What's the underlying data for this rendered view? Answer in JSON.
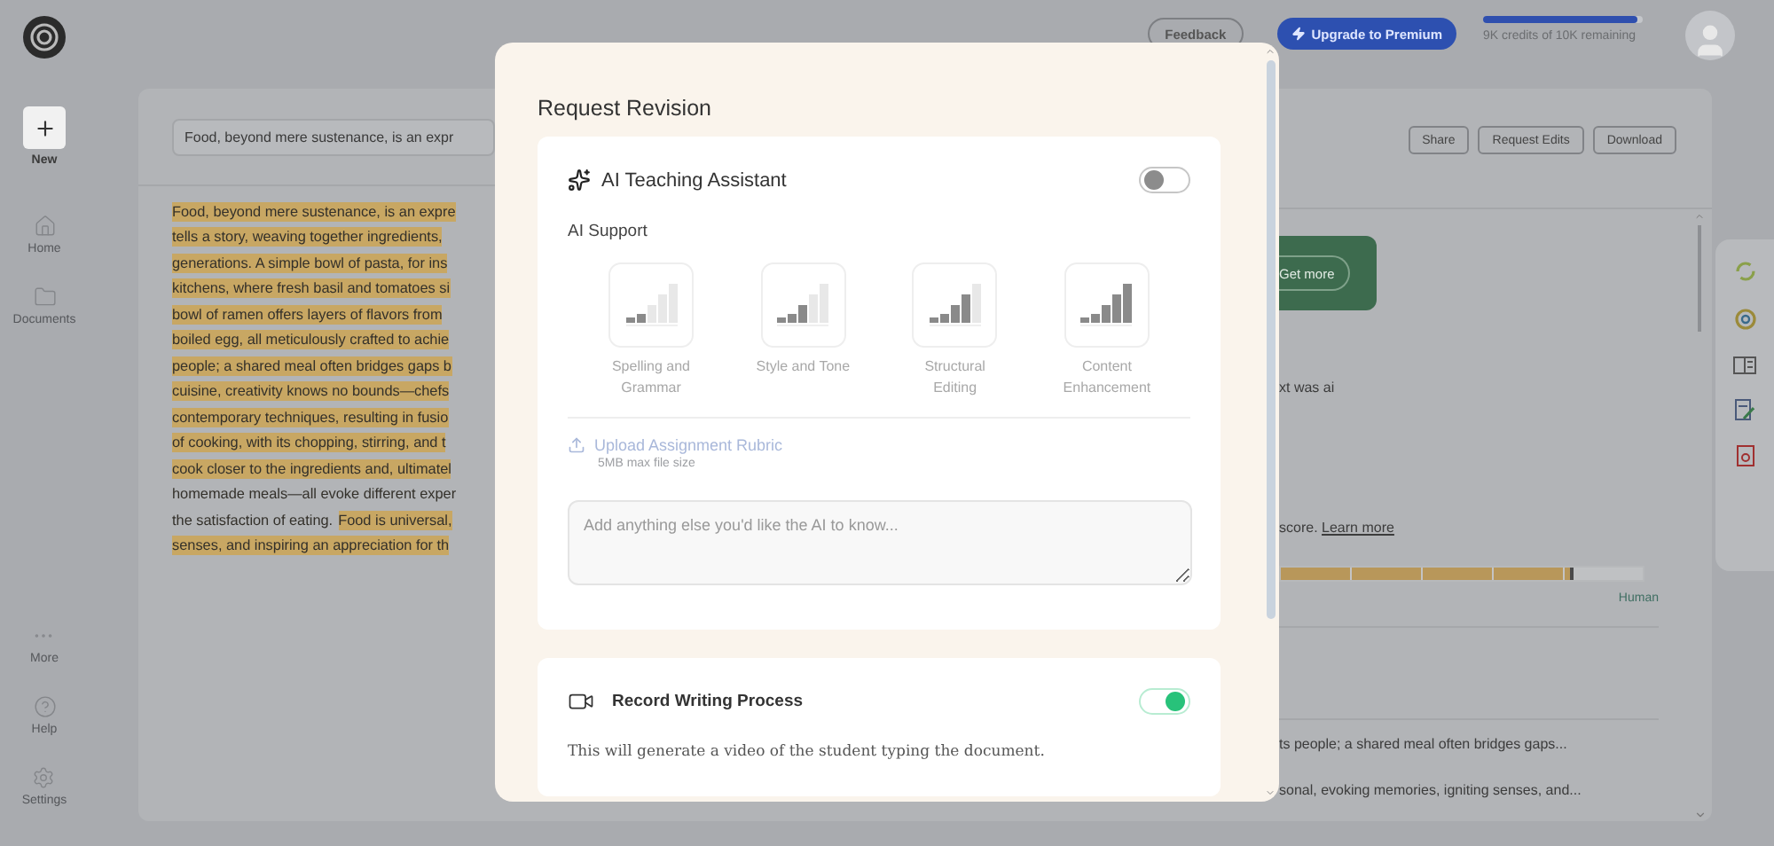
{
  "sidebar": {
    "new_label": "New",
    "items": [
      {
        "label": "Home"
      },
      {
        "label": "Documents"
      }
    ],
    "bottom_items": [
      {
        "label": "More"
      },
      {
        "label": "Help"
      },
      {
        "label": "Settings"
      }
    ]
  },
  "topbar": {
    "feedback": "Feedback",
    "upgrade": "Upgrade to Premium",
    "credits": {
      "level": 0.97,
      "text": "9K credits of 10K remaining"
    }
  },
  "document": {
    "title_field": "Food, beyond mere sustenance, is an expr",
    "lines": [
      [
        {
          "text": "Food, beyond mere sustenance, is an expre",
          "highlighted": true
        }
      ],
      [
        {
          "text": "tells a story, weaving together ingredients, ",
          "highlighted": true
        }
      ],
      [
        {
          "text": "generations. A simple bowl of pasta, for ins",
          "highlighted": true
        }
      ],
      [
        {
          "text": "kitchens, where fresh basil and tomatoes si",
          "highlighted": true
        }
      ],
      [
        {
          "text": "bowl of ramen offers layers of flavors from ",
          "highlighted": true
        }
      ],
      [
        {
          "text": "boiled egg, all meticulously crafted to achie",
          "highlighted": true
        }
      ],
      [
        {
          "text": "people; a shared meal often bridges gaps b",
          "highlighted": true
        }
      ],
      [
        {
          "text": "cuisine, creativity knows no bounds—chefs",
          "highlighted": true
        }
      ],
      [
        {
          "text": "contemporary techniques, resulting in fusio",
          "highlighted": true
        }
      ],
      [
        {
          "text": "of cooking, with its chopping, stirring, and t",
          "highlighted": true
        }
      ],
      [
        {
          "text": "cook closer to the ingredients and, ultimatel",
          "highlighted": true
        }
      ],
      [
        {
          "text": "homemade meals—all evoke different exper",
          "highlighted": false
        }
      ],
      [
        {
          "text": "the satisfaction of eating.",
          "highlighted": false
        },
        {
          "text": "Food is universal,",
          "highlighted": true
        }
      ],
      [
        {
          "text": "senses, and inspiring an appreciation for th",
          "highlighted": true
        }
      ]
    ]
  },
  "report": {
    "actions": [
      "Share",
      "Request Edits",
      "Download"
    ],
    "promo_button": "Get more",
    "detection_text": "xt was ai",
    "score_note": "score.",
    "learn_more": "Learn more",
    "score_bar": {
      "level": 0.81,
      "label": "Human"
    },
    "excerpts": [
      "ts people; a shared meal often bridges gaps...",
      "sonal, evoking memories, igniting senses, and..."
    ]
  },
  "modal": {
    "title": "Request Revision",
    "assistant": {
      "title": "AI Teaching Assistant",
      "enabled": false,
      "support_label": "AI Support",
      "options": [
        {
          "label": "Spelling and Grammar",
          "level": 0.4
        },
        {
          "label": "Style and Tone",
          "level": 0.6
        },
        {
          "label": "Structural Editing",
          "level": 0.8
        },
        {
          "label": "Content Enhancement",
          "level": 1
        }
      ],
      "upload": "Upload Assignment Rubric",
      "upload_note": "5MB max file size",
      "notes_placeholder": "Add anything else you'd like the AI to know..."
    },
    "record": {
      "title": "Record Writing Process",
      "enabled": true,
      "description": "This will generate a video of the student typing the document."
    }
  }
}
